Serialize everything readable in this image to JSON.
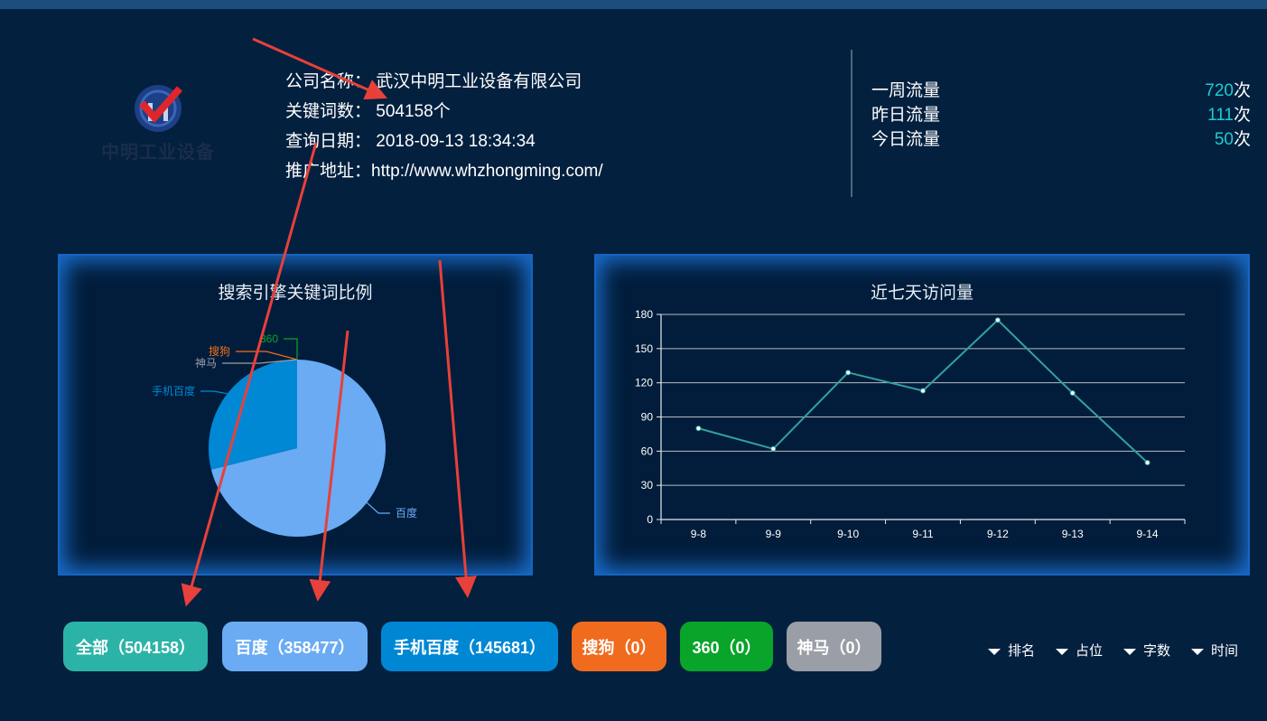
{
  "company": {
    "logo_text": "中明工业设备",
    "name_label": "公司名称：",
    "name_value": "武汉中明工业设备有限公司",
    "keywords_label": "关键词数：",
    "keywords_value": "504158个",
    "query_date_label": "查询日期：",
    "query_date_value": "2018-09-13 18:34:34",
    "url_label": "推广地址：",
    "url_value": "http://www.whzhongming.com/"
  },
  "traffic": [
    {
      "label": "一周流量",
      "value": "720",
      "unit": "次"
    },
    {
      "label": "昨日流量",
      "value": "111",
      "unit": "次"
    },
    {
      "label": "今日流量",
      "value": "50",
      "unit": "次"
    }
  ],
  "pie_panel": {
    "title": "搜索引擎关键词比例"
  },
  "line_panel": {
    "title": "近七天访问量"
  },
  "chart_data": [
    {
      "type": "pie",
      "title": "搜索引擎关键词比例",
      "slices": [
        {
          "name": "百度",
          "value": 358477,
          "color": "#6aabf4"
        },
        {
          "name": "手机百度",
          "value": 145681,
          "color": "#0088d4"
        },
        {
          "name": "神马",
          "value": 0,
          "color": "#9a9ea6"
        },
        {
          "name": "搜狗",
          "value": 0,
          "color": "#ef6e1e"
        },
        {
          "name": "360",
          "value": 0,
          "color": "#08a72b"
        }
      ]
    },
    {
      "type": "line",
      "title": "近七天访问量",
      "categories": [
        "9-8",
        "9-9",
        "9-10",
        "9-11",
        "9-12",
        "9-13",
        "9-14"
      ],
      "values": [
        80,
        62,
        129,
        113,
        175,
        111,
        50
      ],
      "ylim": [
        0,
        180
      ],
      "yticks": [
        0,
        30,
        60,
        90,
        120,
        150,
        180
      ],
      "grid": true,
      "color": "#33a1a0"
    }
  ],
  "filters": [
    {
      "label": "全部（504158）",
      "color": "#2cb3a8"
    },
    {
      "label": "百度（358477）",
      "color": "#6aabf4"
    },
    {
      "label": "手机百度（145681）",
      "color": "#0087d4"
    },
    {
      "label": "搜狗（0）",
      "color": "#f06b1d"
    },
    {
      "label": "360（0）",
      "color": "#08a52a"
    },
    {
      "label": "神马（0）",
      "color": "#9a9ea6"
    }
  ],
  "sorts": [
    {
      "label": "排名",
      "icon": "caret-down-icon"
    },
    {
      "label": "占位",
      "icon": "caret-down-icon"
    },
    {
      "label": "字数",
      "icon": "caret-down-icon"
    },
    {
      "label": "时间",
      "icon": "caret-down-icon"
    }
  ],
  "colors": {
    "background": "#03203f",
    "accent": "#1ecbd0",
    "panel_border": "#1565c0",
    "annotation_arrow": "#e8403a"
  }
}
